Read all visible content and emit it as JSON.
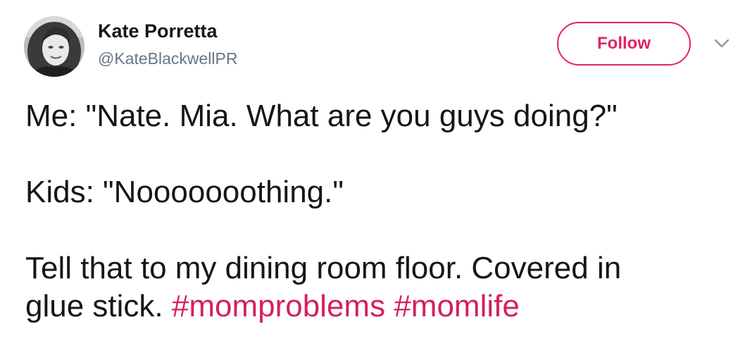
{
  "author": {
    "name": "Kate Porretta",
    "handle": "@KateBlackwellPR"
  },
  "actions": {
    "follow_label": "Follow"
  },
  "icons": {
    "menu": "chevron-down-icon"
  },
  "colors": {
    "accent": "#e0245e",
    "hashtag": "#d42060",
    "handle": "#657786",
    "text": "#14171a"
  },
  "tweet": {
    "line1": "Me: \"Nate. Mia. What are you guys doing?\"",
    "line2": "Kids: \"Nooooooothing.\"",
    "line3": "Tell that to my dining room floor. Covered in",
    "line4_text": "glue stick.",
    "hashtags": [
      "#momproblems",
      "#momlife"
    ]
  }
}
